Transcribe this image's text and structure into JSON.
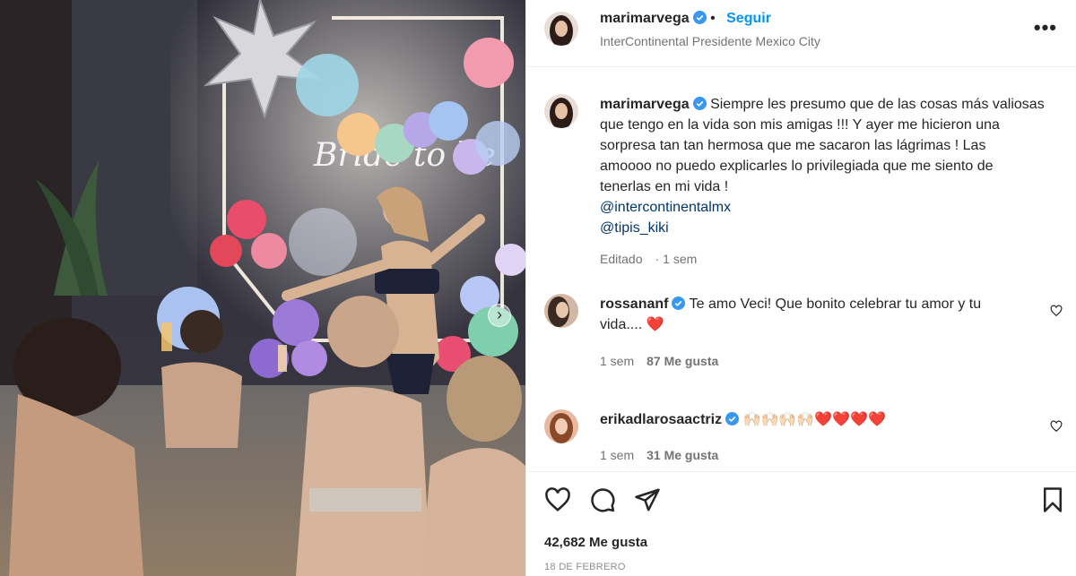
{
  "post": {
    "username": "marimarvega",
    "follow_label": "Seguir",
    "location": "InterContinental Presidente Mexico City",
    "more_label": "•••",
    "media_alt": "Fiesta en la alberca con globos y luces neón",
    "neon_text": "Bride to be"
  },
  "caption": {
    "username": "marimarvega",
    "lines": [
      "Siempre les presumo que de las cosas más valiosas",
      "que tengo en la vida son mis amigas !!! Y ayer me hicieron una",
      "sorpresa tan tan hermosa que me sacaron las lágrimas ! Las",
      "amoooo no puedo explicarles lo privilegiada que me siento de",
      "tenerlas en mi vida !"
    ],
    "mentions": [
      "@intercontinentalmx",
      "@tipis_kiki"
    ],
    "edited": "Editado",
    "time": "1 sem"
  },
  "comments": [
    {
      "username": "rossananf",
      "text_line1": "Te amo Veci! Que bonito celebrar tu amor y tu",
      "text_line2": "vida....",
      "emoji": "❤️",
      "time": "1 sem",
      "likes": "87 Me gusta"
    },
    {
      "username": "erikadlarosaactriz",
      "emoji": "🙌🏻🙌🏻🙌🏻🙌🏻❤️❤️❤️❤️",
      "time": "1 sem",
      "likes": "31 Me gusta"
    }
  ],
  "footer": {
    "likes": "42,682 Me gusta",
    "date": "18 DE FEBRERO"
  },
  "colors": {
    "accent": "#0095f6",
    "verified": "#3897f0",
    "heart": "#ed4956",
    "muted": "#737373"
  },
  "icons": [
    "verified-icon",
    "more-icon",
    "heart-icon",
    "comment-icon",
    "share-icon",
    "bookmark-icon",
    "carousel-next-icon"
  ]
}
